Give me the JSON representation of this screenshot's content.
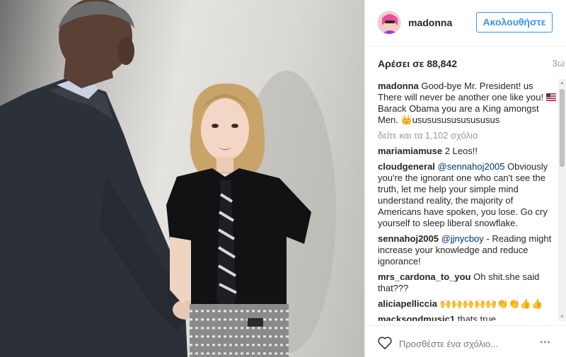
{
  "header": {
    "username": "madonna",
    "follow_label": "Ακολουθήστε"
  },
  "post": {
    "likes": "Αρέσει σε 88,842",
    "time_ago": "3ω"
  },
  "caption": {
    "user": "madonna",
    "text_1": "Good-bye Mr. President! us There will never be another one like you!",
    "text_2": "Barack Obama you are a King amongst Men. 👑ususususususususus"
  },
  "more_comments": "δείτε και τα 1,102 σχόλια",
  "comments": [
    {
      "user": "mariamiamuse",
      "mention": "",
      "text": "2 Leos!!"
    },
    {
      "user": "cloudgeneral",
      "mention": "@sennahoj2005",
      "text": "Obviously you're the ignorant one who can't see the truth, let me help your simple mind understand reality, the majority of Americans have spoken, you lose. Go cry yourself to sleep liberal snowflake."
    },
    {
      "user": "sennahoj2005",
      "mention": "@jjnycboy",
      "text": "- Reading might increase your knowledge and reduce ignorance!"
    },
    {
      "user": "mrs_cardona_to_you",
      "mention": "",
      "text": "Oh shit.she said that???"
    },
    {
      "user": "aliciapelliccia",
      "mention": "",
      "text": "🙌🙌🙌🙌🙌👏👏👍👍"
    },
    {
      "user": "macksondmusic1",
      "mention": "",
      "text": "thats true"
    }
  ],
  "footer": {
    "comment_placeholder": "Προσθέστε ένα σχόλιο...",
    "more_options": "•••"
  },
  "colors": {
    "accent": "#3897f0",
    "text": "#262626",
    "muted": "#999999",
    "mention": "#003569"
  },
  "icons": {
    "like": "heart-outline-icon",
    "more": "more-options-icon",
    "avatar": "profile-avatar"
  }
}
